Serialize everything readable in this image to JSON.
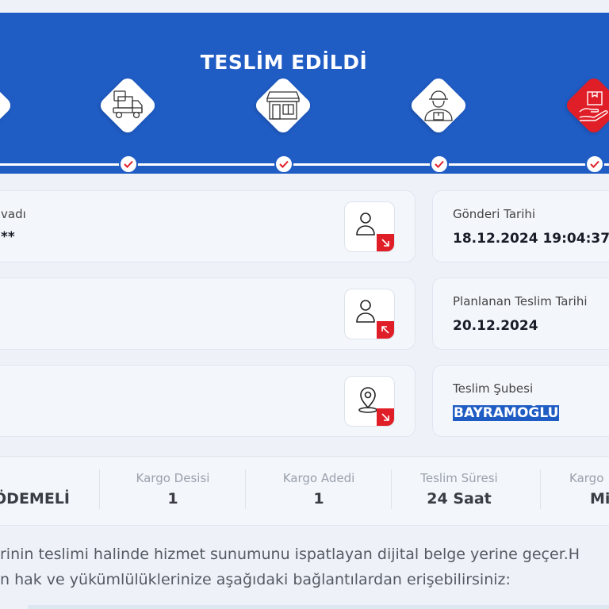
{
  "banner": {
    "title": "TESLİM EDİLDİ",
    "bg_color": "#1f5cc4",
    "steps": [
      {
        "icon": "partial-step-icon",
        "done": true
      },
      {
        "icon": "truck-icon",
        "done": true
      },
      {
        "icon": "branch-store-icon",
        "done": true
      },
      {
        "icon": "courier-icon",
        "done": true
      },
      {
        "icon": "package-hand-icon",
        "done": true,
        "active": true
      }
    ],
    "accent_color": "#e01e27"
  },
  "cards": {
    "sender": {
      "label": "vadı",
      "value": "**",
      "icon": "user-out-icon"
    },
    "receiver": {
      "label": "",
      "value": "",
      "icon": "user-in-icon"
    },
    "branch": {
      "label": "",
      "value": "",
      "icon": "location-icon"
    },
    "send_date": {
      "label": "Gönderi Tarihi",
      "value": "18.12.2024 19:04:37"
    },
    "planned_date": {
      "label": "Planlanan Teslim Tarihi",
      "value": "20.12.2024"
    },
    "delivery_branch": {
      "label": "Teslim Şubesi",
      "value": "BAYRAMOĞLU"
    }
  },
  "stats": [
    {
      "label": "",
      "value": "ÖDEMELİ"
    },
    {
      "label": "Kargo Desisi",
      "value": "1"
    },
    {
      "label": "Kargo Adedi",
      "value": "1"
    },
    {
      "label": "Teslim Süresi",
      "value": "24 Saat"
    },
    {
      "label": "Kargo",
      "value": "Mi"
    }
  ],
  "info": {
    "line1": "rinin teslimi halinde hizmet sunumunu ispatlayan dijital belge yerine geçer.H",
    "line2": "n hak ve yükümlülüklerinize aşağıdaki bağlantılardan erişebilirsiniz:"
  }
}
